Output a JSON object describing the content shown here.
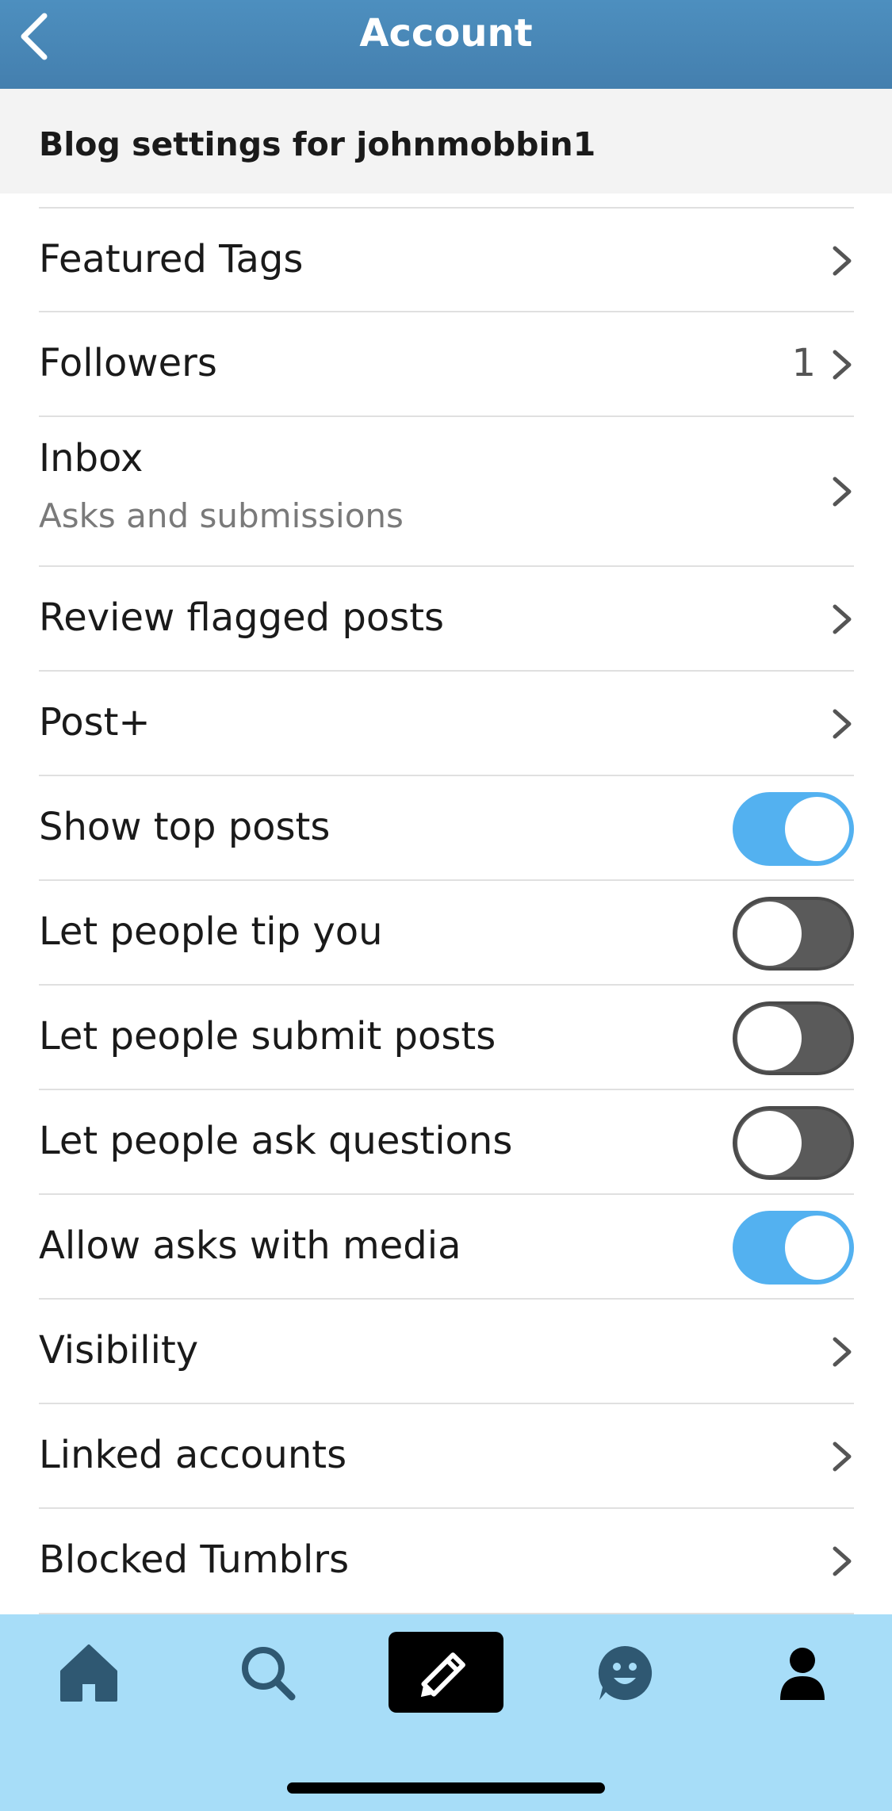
{
  "header": {
    "title": "Account"
  },
  "blog_settings": {
    "title": "Blog settings for johnmobbin1"
  },
  "rows": {
    "featured_tags": {
      "label": "Featured Tags"
    },
    "followers": {
      "label": "Followers",
      "count": "1"
    },
    "inbox": {
      "label": "Inbox",
      "subtitle": "Asks and submissions"
    },
    "review_flagged": {
      "label": "Review flagged posts"
    },
    "post_plus": {
      "label": "Post+"
    },
    "show_top_posts": {
      "label": "Show top posts",
      "enabled": true
    },
    "tip_you": {
      "label": "Let people tip you",
      "enabled": false
    },
    "submit_posts": {
      "label": "Let people submit posts",
      "enabled": false
    },
    "ask_questions": {
      "label": "Let people ask questions",
      "enabled": false
    },
    "asks_media": {
      "label": "Allow asks with media",
      "enabled": true
    },
    "visibility": {
      "label": "Visibility"
    },
    "linked_accounts": {
      "label": "Linked accounts"
    },
    "blocked": {
      "label": "Blocked Tumblrs"
    }
  },
  "tabbar": {
    "items": [
      "home-icon",
      "search-icon",
      "compose-pencil-icon",
      "activity-face-icon",
      "account-person-icon"
    ]
  },
  "colors": {
    "header": "#447fae",
    "toggle_on": "#53b1f0",
    "toggle_off": "#5a5a5a",
    "tabbar": "#a7ddf8"
  }
}
